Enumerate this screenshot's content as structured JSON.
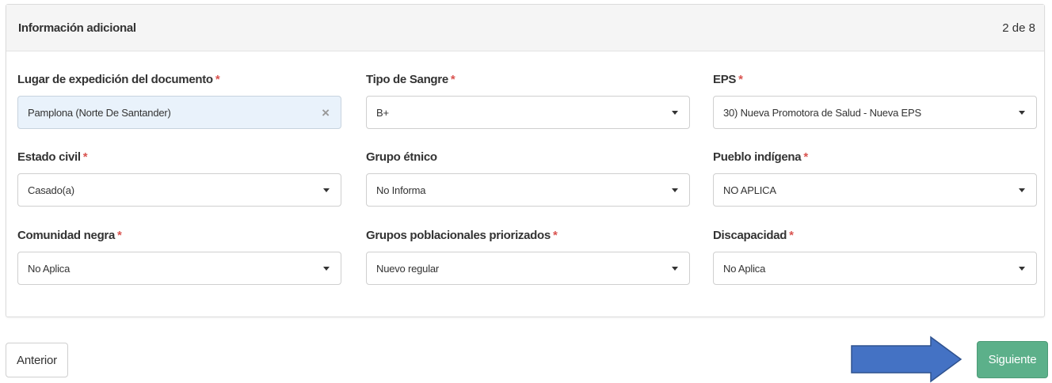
{
  "panel": {
    "title": "Información adicional",
    "step": "2 de 8"
  },
  "required_mark": "*",
  "fields": {
    "lugar": {
      "label": "Lugar de expedición del documento",
      "required": true,
      "value": "Pamplona (Norte De Santander)",
      "clear_icon": "×"
    },
    "sangre": {
      "label": "Tipo de Sangre",
      "required": true,
      "value": "B+"
    },
    "eps": {
      "label": "EPS",
      "required": true,
      "value": "30) Nueva Promotora de Salud - Nueva EPS"
    },
    "estado_civil": {
      "label": "Estado civil",
      "required": true,
      "value": "Casado(a)"
    },
    "grupo_etnico": {
      "label": "Grupo étnico",
      "required": false,
      "value": "No Informa"
    },
    "pueblo_indigena": {
      "label": "Pueblo indígena",
      "required": true,
      "value": "NO APLICA"
    },
    "comunidad_negra": {
      "label": "Comunidad negra",
      "required": true,
      "value": "No Aplica"
    },
    "grupos_poblacionales": {
      "label": "Grupos poblacionales priorizados",
      "required": true,
      "value": "Nuevo regular"
    },
    "discapacidad": {
      "label": "Discapacidad",
      "required": true,
      "value": "No Aplica"
    }
  },
  "buttons": {
    "previous": "Anterior",
    "next": "Siguiente"
  },
  "colors": {
    "required": "#d9534f",
    "next_button": "#5cb08a",
    "arrow_fill": "#4472c4",
    "arrow_stroke": "#2f528f",
    "selected_field_bg": "#e9f2fb"
  },
  "icons": {
    "dropdown": "caret-down-icon",
    "clear": "clear-icon",
    "annotation": "right-arrow-icon"
  }
}
